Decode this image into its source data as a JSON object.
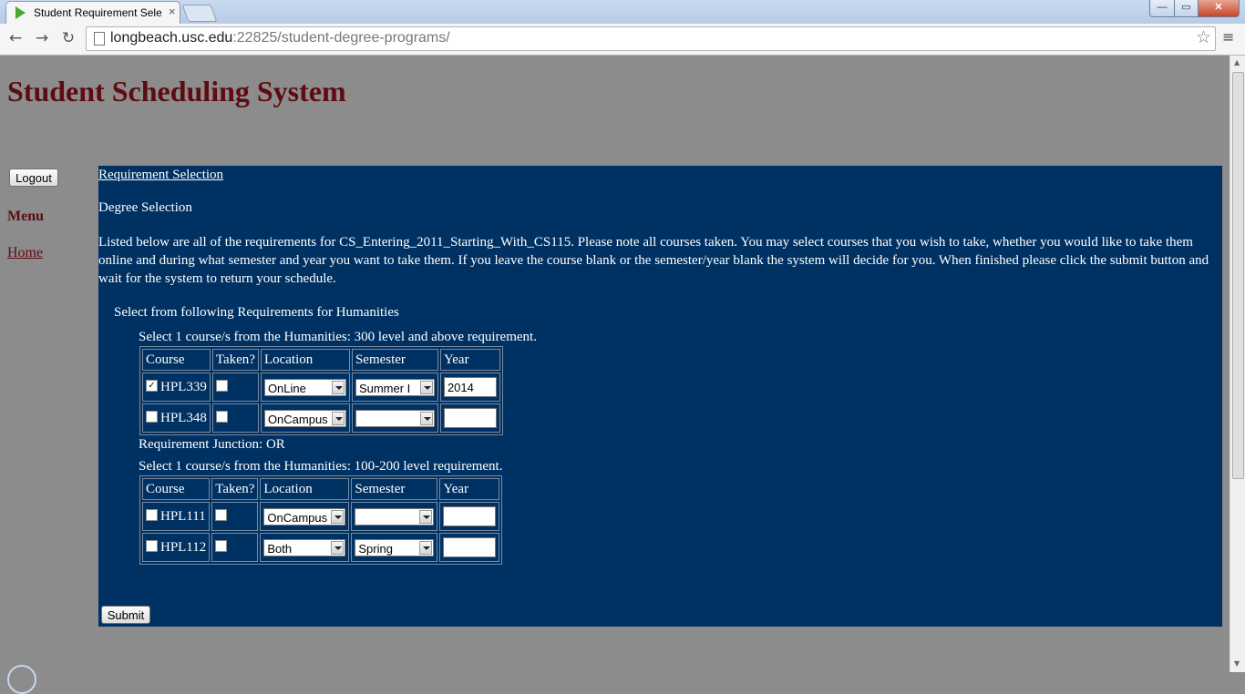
{
  "browser": {
    "tab_title": "Student Requirement Sele",
    "tab_close": "×",
    "url_host": "longbeach.usc.edu",
    "url_rest": ":22825/student-degree-programs/",
    "window_min": "—",
    "window_max": "▭",
    "window_close": "✕",
    "back_icon": "←",
    "forward_icon": "→",
    "reload_icon": "↻",
    "star_icon": "☆",
    "menu_icon": "≡"
  },
  "page": {
    "title": "Student Scheduling System",
    "logout_label": "Logout",
    "menu_heading": "Menu",
    "home_link": "Home"
  },
  "main": {
    "requirement_selection_link": "Requirement Selection",
    "degree_selection": "Degree Selection",
    "intro": "Listed below are all of the requirements for CS_Entering_2011_Starting_With_CS115. Please note all courses taken. You may select courses that you wish to take, whether you would like to take them online and during what semester and year you want to take them. If you leave the course blank or the semester/year blank the system will decide for you. When finished please click the submit button and wait for the system to return your schedule.",
    "group_title": "Select from following Requirements for Humanities",
    "headers": {
      "course": "Course",
      "taken": "Taken?",
      "location": "Location",
      "semester": "Semester",
      "year": "Year"
    },
    "requirement1": {
      "title": "Select 1 course/s from the Humanities: 300 level and above requirement.",
      "rows": [
        {
          "course": "HPL339",
          "selected": "✓",
          "taken": "",
          "location": "OnLine",
          "semester": "Summer I",
          "year": "2014"
        },
        {
          "course": "HPL348",
          "selected": "",
          "taken": "",
          "location": "OnCampus",
          "semester": "",
          "year": ""
        }
      ]
    },
    "junction": "Requirement Junction: OR",
    "requirement2": {
      "title": "Select 1 course/s from the Humanities: 100-200 level requirement.",
      "rows": [
        {
          "course": "HPL111",
          "selected": "",
          "taken": "",
          "location": "OnCampus",
          "semester": "",
          "year": ""
        },
        {
          "course": "HPL112",
          "selected": "",
          "taken": "",
          "location": "Both",
          "semester": "Spring",
          "year": ""
        }
      ]
    },
    "submit_label": "Submit"
  },
  "colors": {
    "page_background": "#8c8c8c",
    "panel_background": "#003163",
    "title_color": "#5e0b12"
  }
}
